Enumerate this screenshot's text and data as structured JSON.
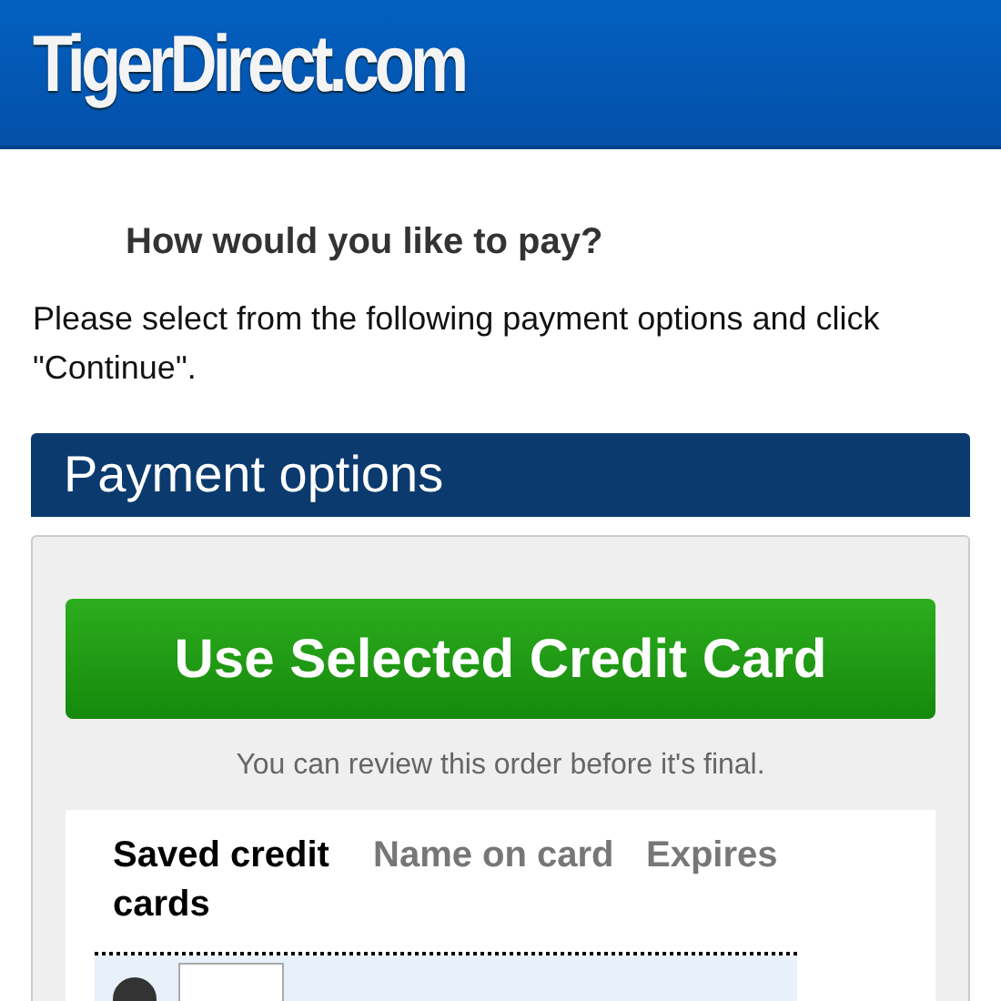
{
  "header": {
    "logo": "TigerDirect.com"
  },
  "prompt": {
    "title": "How would you like to pay?",
    "instructions": "Please select from the following payment options and click \"Continue\"."
  },
  "payment_options": {
    "title": "Payment options",
    "button": "Use Selected Credit Card",
    "note": "You can review this order before it's final.",
    "table": {
      "columns": [
        {
          "label": "Saved credit cards",
          "active": true
        },
        {
          "label": "Name on card",
          "active": false
        },
        {
          "label": "Expires",
          "active": false
        }
      ],
      "rows": [
        {
          "selected": true
        }
      ]
    }
  }
}
